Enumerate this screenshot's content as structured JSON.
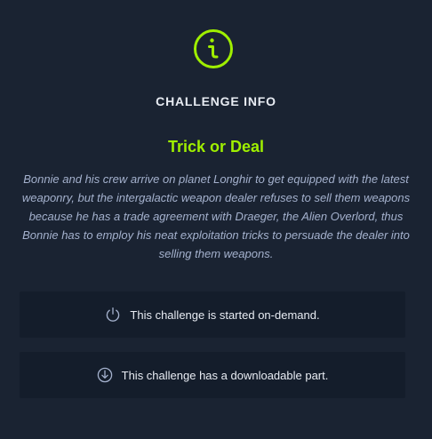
{
  "header": {
    "icon": "info-icon",
    "title": "CHALLENGE INFO"
  },
  "challenge": {
    "name": "Trick or Deal",
    "description": "Bonnie and his crew arrive on planet Longhir to get equipped with the latest weaponry, but the intergalactic weapon dealer refuses to sell them weapons because he has a trade agreement with Draeger, the Alien Overlord, thus Bonnie has to employ his neat exploitation tricks to persuade the dealer into selling them weapons."
  },
  "cards": [
    {
      "icon": "power-icon",
      "text": "This challenge is started on-demand."
    },
    {
      "icon": "download-icon",
      "text": "This challenge has a downloadable part."
    }
  ],
  "colors": {
    "background": "#1a2332",
    "card_background": "#141d2b",
    "accent": "#9fef00",
    "text": "#e8ecf3",
    "muted_text": "#a4b1cd"
  }
}
